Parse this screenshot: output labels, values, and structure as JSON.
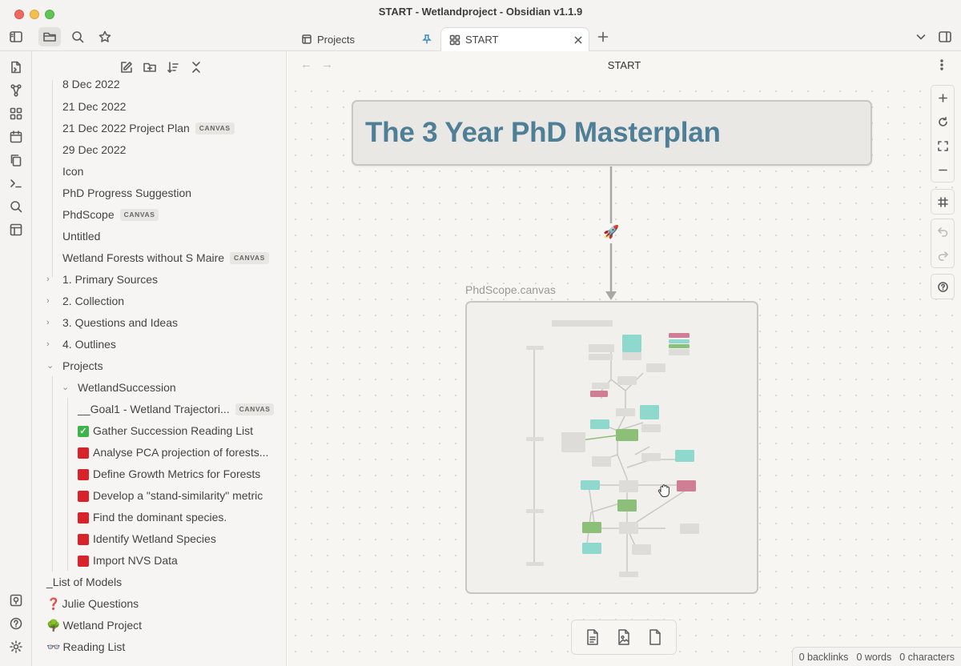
{
  "window": {
    "title": "START - Wetlandproject - Obsidian v1.1.9"
  },
  "tabs": [
    {
      "label": "Projects"
    },
    {
      "label": "START"
    }
  ],
  "view": {
    "title": "START"
  },
  "sidebar": {
    "items": [
      {
        "label": "8 Dec 2022"
      },
      {
        "label": "21 Dec 2022"
      },
      {
        "label": "21 Dec 2022 Project Plan",
        "badge": "CANVAS"
      },
      {
        "label": "29 Dec 2022"
      },
      {
        "label": "Icon"
      },
      {
        "label": "PhD Progress Suggestion"
      },
      {
        "label": "PhdScope",
        "badge": "CANVAS"
      },
      {
        "label": "Untitled"
      },
      {
        "label": "Wetland Forests without S Maire",
        "badge": "CANVAS"
      },
      {
        "label": "1. Primary Sources"
      },
      {
        "label": "2. Collection"
      },
      {
        "label": "3. Questions and Ideas"
      },
      {
        "label": "4. Outlines"
      },
      {
        "label": "Projects"
      },
      {
        "label": "WetlandSuccession"
      },
      {
        "label": "__Goal1 - Wetland Trajectori...",
        "badge": "CANVAS"
      },
      {
        "label": "Gather Succession Reading List"
      },
      {
        "label": "Analyse PCA projection of forests..."
      },
      {
        "label": "Define Growth Metrics for Forests"
      },
      {
        "label": "Develop a \"stand-similarity\" metric"
      },
      {
        "label": "Find the dominant species."
      },
      {
        "label": "Identify Wetland Species"
      },
      {
        "label": "Import NVS Data"
      },
      {
        "label": "_List of Models"
      },
      {
        "label": "Julie Questions",
        "emoji": "❓"
      },
      {
        "label": "Wetland Project",
        "emoji": "🌳"
      },
      {
        "label": "Reading List",
        "emoji": "👓"
      }
    ]
  },
  "canvas": {
    "title_card": "The 3 Year PhD Masterplan",
    "edge_label": "🚀",
    "embed_label": "PhdScope.canvas"
  },
  "status": {
    "backlinks": "0 backlinks",
    "words": "0 words",
    "characters": "0 characters"
  },
  "colors": {
    "accent": "#4f7f96",
    "teal": "#8fd8cd",
    "green": "#8cbf77",
    "pink": "#d07e93"
  }
}
